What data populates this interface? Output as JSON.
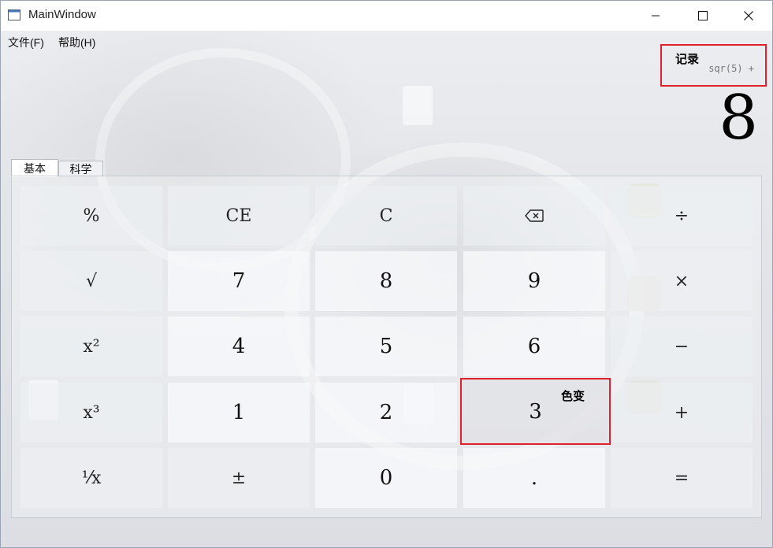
{
  "window": {
    "title": "MainWindow"
  },
  "menu": {
    "file": "文件(F)",
    "help": "帮助(H)"
  },
  "history": {
    "title": "记录",
    "expression": "sqr(5) +"
  },
  "display": {
    "value": "8"
  },
  "tabs": [
    {
      "label": "基本",
      "active": true
    },
    {
      "label": "科学",
      "active": false
    }
  ],
  "keypad": {
    "rows": [
      [
        "%",
        "CE",
        "C",
        "⌫",
        "÷"
      ],
      [
        "√",
        "7",
        "8",
        "9",
        "×"
      ],
      [
        "x²",
        "4",
        "5",
        "6",
        "−"
      ],
      [
        "x³",
        "1",
        "2",
        "3",
        "+"
      ],
      [
        "¹⁄x",
        "±",
        "0",
        ".",
        "="
      ]
    ]
  },
  "annotation": {
    "color_change": "色变"
  },
  "colors": {
    "highlight_border": "#e0202a",
    "title_bar": "#ffffff"
  }
}
